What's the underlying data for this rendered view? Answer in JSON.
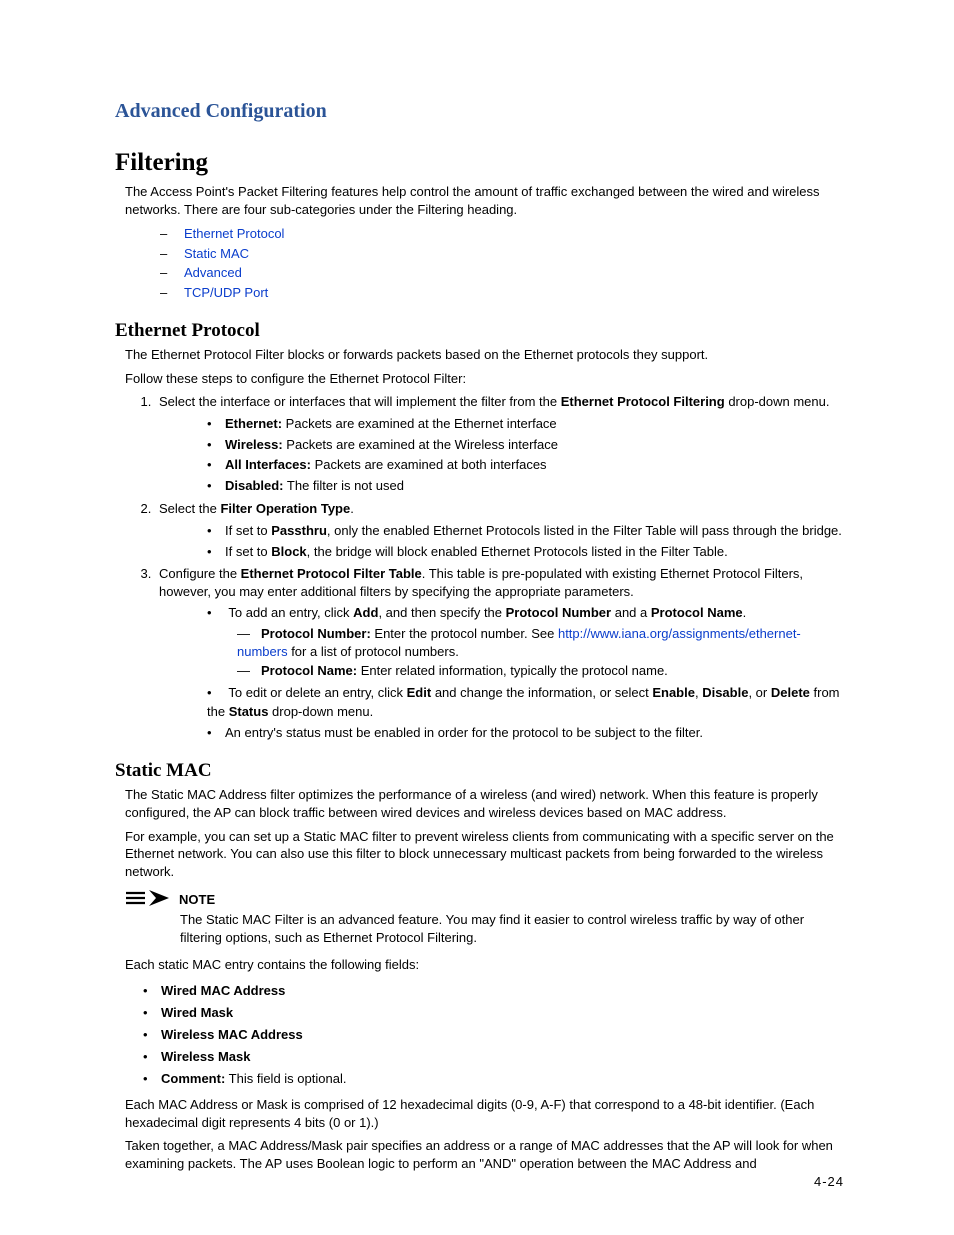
{
  "breadcrumb": "Advanced Configuration",
  "h1": "Filtering",
  "intro": "The Access Point's Packet Filtering features help control the amount of traffic exchanged between the wired and wireless networks. There are four sub-categories under the Filtering heading.",
  "toc": {
    "ethernet": "Ethernet Protocol",
    "staticmac": "Static MAC",
    "advanced": "Advanced",
    "tcpudp": "TCP/UDP Port"
  },
  "eth": {
    "heading": "Ethernet Protocol",
    "p1": "The Ethernet Protocol Filter blocks or forwards packets based on the Ethernet protocols they support.",
    "p2": "Follow these steps to configure the Ethernet Protocol Filter:",
    "step1_a": "Select the interface or interfaces that will implement the filter from the ",
    "step1_b": "Ethernet Protocol Filtering",
    "step1_c": " drop-down menu.",
    "opt_ethernet_l": "Ethernet:",
    "opt_ethernet_t": " Packets are examined at the Ethernet interface",
    "opt_wireless_l": "Wireless:",
    "opt_wireless_t": " Packets are examined at the Wireless interface",
    "opt_all_l": "All Interfaces:",
    "opt_all_t": " Packets are examined at both interfaces",
    "opt_disabled_l": "Disabled:",
    "opt_disabled_t": " The filter is not used",
    "step2_a": "Select the ",
    "step2_b": "Filter Operation Type",
    "step2_c": ".",
    "passthru_a": "If set to ",
    "passthru_b": "Passthru",
    "passthru_c": ", only the enabled Ethernet Protocols listed in the Filter Table will pass through the bridge.",
    "block_a": "If set to ",
    "block_b": "Block",
    "block_c": ", the bridge will block enabled Ethernet Protocols listed in the Filter Table.",
    "step3_a": "Configure the ",
    "step3_b": "Ethernet Protocol Filter Table",
    "step3_c": ". This table is pre-populated with existing Ethernet Protocol Filters, however, you may enter additional filters by specifying the appropriate parameters.",
    "add_a": "To add an entry, click ",
    "add_b": "Add",
    "add_c": ", and then specify the ",
    "add_d": "Protocol Number",
    "add_e": " and a ",
    "add_f": "Protocol Name",
    "add_g": ".",
    "pnum_l": "Protocol Number:",
    "pnum_t1": " Enter the protocol number. See ",
    "pnum_link": "http://www.iana.org/assignments/ethernet-numbers",
    "pnum_t2": " for a list of protocol numbers.",
    "pname_l": "Protocol Name:",
    "pname_t": " Enter related information, typically the protocol name.",
    "edit_a": "To edit or delete an entry, click ",
    "edit_b": "Edit",
    "edit_c": " and change the information, or select ",
    "edit_d": "Enable",
    "edit_e": ", ",
    "edit_f": "Disable",
    "edit_g": ", or ",
    "edit_h": "Delete",
    "edit_i": " from the ",
    "edit_j": "Status",
    "edit_k": " drop-down menu.",
    "status_note": "An entry's status must be enabled in order for the protocol to be subject to the filter."
  },
  "mac": {
    "heading": "Static MAC",
    "p1": "The Static MAC Address filter optimizes the performance of a wireless (and wired) network. When this feature is properly configured, the AP can block traffic between wired devices and wireless devices based on MAC address.",
    "p2": "For example, you can set up a Static MAC filter to prevent wireless clients from communicating with a specific server on the Ethernet network. You can also use this filter to block unnecessary multicast packets from being forwarded to the wireless network.",
    "note_label": "NOTE",
    "note_body": "The Static MAC Filter is an advanced feature. You may find it easier to control wireless traffic by way of other filtering options, such as Ethernet Protocol Filtering.",
    "p3": "Each static MAC entry contains the following fields:",
    "f1": "Wired MAC Address",
    "f2": "Wired Mask",
    "f3": "Wireless MAC Address",
    "f4": "Wireless Mask",
    "f5_l": "Comment:",
    "f5_t": " This field is optional.",
    "p4": "Each MAC Address or Mask is comprised of 12 hexadecimal digits (0-9, A-F) that correspond to a 48-bit identifier. (Each hexadecimal digit represents 4 bits (0 or 1).)",
    "p5": "Taken together, a MAC Address/Mask pair specifies an address or a range of MAC addresses that the AP will look for when examining packets. The AP uses Boolean logic to perform an \"AND\" operation between the MAC Address and"
  },
  "page_number": "4-24"
}
